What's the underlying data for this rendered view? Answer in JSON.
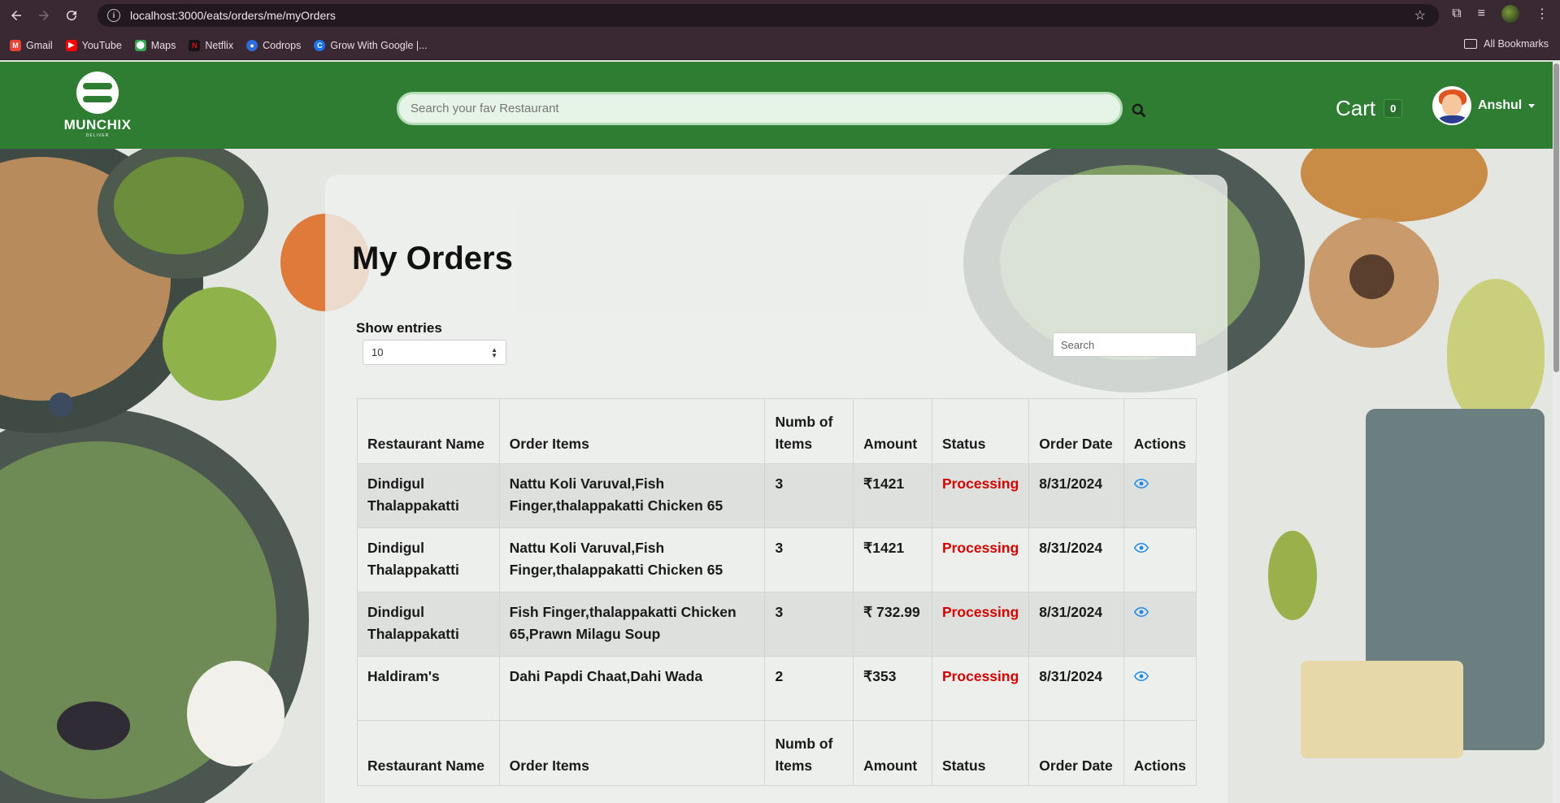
{
  "browser": {
    "url": "localhost:3000/eats/orders/me/myOrders",
    "bookmarks": [
      {
        "label": "Gmail",
        "color": "#ea4335"
      },
      {
        "label": "YouTube",
        "color": "#ff0000"
      },
      {
        "label": "Maps",
        "color": "#34a853"
      },
      {
        "label": "Netflix",
        "color": "#e50914"
      },
      {
        "label": "Codrops",
        "color": "#2d6cdf"
      },
      {
        "label": "Grow With Google |...",
        "color": "#1a73e8"
      }
    ],
    "all_bookmarks": "All Bookmarks"
  },
  "header": {
    "logo_text": "MUNCHIX",
    "logo_sub": "DELIVER",
    "search_placeholder": "Search your fav Restaurant",
    "cart_label": "Cart",
    "cart_count": "0",
    "user_name": "Anshul",
    "brand_color": "#2e7d32"
  },
  "main": {
    "title": "My Orders",
    "show_entries_label": "Show entries",
    "entries_value": "10",
    "search_placeholder": "Search",
    "columns": [
      "Restaurant Name",
      "Order Items",
      "Numb of Items",
      "Amount",
      "Status",
      "Order Date",
      "Actions"
    ],
    "orders": [
      {
        "restaurant": "Dindigul Thalappakatti",
        "items": "Nattu Koli Varuval,Fish Finger,thalappakatti Chicken 65",
        "count": "3",
        "amount": "₹1421",
        "status": "Processing",
        "date": "8/31/2024",
        "action": "eye-icon"
      },
      {
        "restaurant": "Dindigul Thalappakatti",
        "items": "Nattu Koli Varuval,Fish Finger,thalappakatti Chicken 65",
        "count": "3",
        "amount": "₹1421",
        "status": "Processing",
        "date": "8/31/2024",
        "action": "eye-icon"
      },
      {
        "restaurant": "Dindigul Thalappakatti",
        "items": "Fish Finger,thalappakatti Chicken 65,Prawn Milagu Soup",
        "count": "3",
        "amount": "₹ 732.99",
        "status": "Processing",
        "date": "8/31/2024",
        "action": "eye-icon"
      },
      {
        "restaurant": "Haldiram's",
        "items": "Dahi Papdi Chaat,Dahi Wada",
        "count": "2",
        "amount": "₹353",
        "status": "Processing",
        "date": "8/31/2024",
        "action": "eye-icon"
      }
    ],
    "status_color": "#d40000",
    "action_color": "#1e88e5"
  }
}
